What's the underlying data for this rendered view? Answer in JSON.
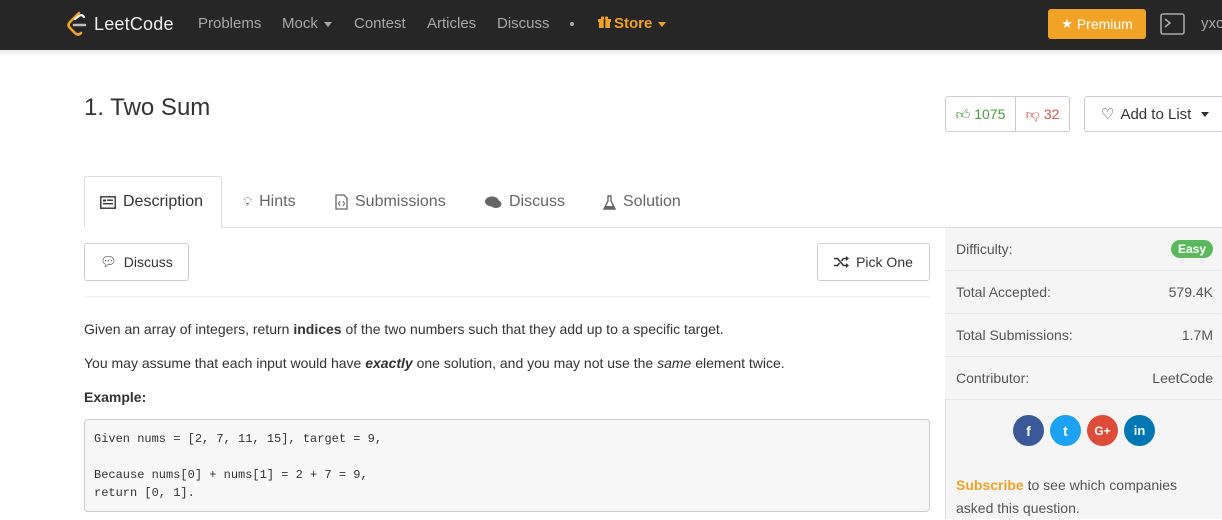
{
  "navbar": {
    "logo_text": "LeetCode",
    "items": [
      "Problems",
      "Mock",
      "Contest",
      "Articles",
      "Discuss"
    ],
    "store_label": "Store",
    "premium_label": "Premium",
    "user_partial": "yxc"
  },
  "problem": {
    "title": "1. Two Sum",
    "likes": "1075",
    "dislikes": "32",
    "add_to_list": "Add to List"
  },
  "tabs": [
    {
      "label": "Description",
      "icon": "description-icon"
    },
    {
      "label": "Hints",
      "icon": "lightbulb-icon"
    },
    {
      "label": "Submissions",
      "icon": "code-file-icon"
    },
    {
      "label": "Discuss",
      "icon": "comments-icon"
    },
    {
      "label": "Solution",
      "icon": "flask-icon"
    }
  ],
  "actions": {
    "discuss": "Discuss",
    "pick_one": "Pick One"
  },
  "description": {
    "p1_a": "Given an array of integers, return ",
    "p1_b": "indices",
    "p1_c": " of the two numbers such that they add up to a specific target.",
    "p2_a": "You may assume that each input would have ",
    "p2_b": "exactly",
    "p2_c": " one solution, and you may not use the ",
    "p2_d": "same",
    "p2_e": " element twice.",
    "example_label": "Example:",
    "example_code": "Given nums = [2, 7, 11, 15], target = 9,\n\nBecause nums[0] + nums[1] = 2 + 7 = 9,\nreturn [0, 1]."
  },
  "sidebar": {
    "difficulty_label": "Difficulty:",
    "difficulty_value": "Easy",
    "accepted_label": "Total Accepted:",
    "accepted_value": "579.4K",
    "submissions_label": "Total Submissions:",
    "submissions_value": "1.7M",
    "contributor_label": "Contributor:",
    "contributor_value": "LeetCode",
    "social": [
      {
        "icon": "facebook-icon",
        "glyph": "f",
        "color": "#3b5998"
      },
      {
        "icon": "twitter-icon",
        "glyph": "t",
        "color": "#1da1f2"
      },
      {
        "icon": "google-plus-icon",
        "glyph": "G+",
        "color": "#dd4b39"
      },
      {
        "icon": "linkedin-icon",
        "glyph": "in",
        "color": "#0077b5"
      }
    ],
    "subscribe_link": "Subscribe",
    "subscribe_text": " to see which companies asked this question."
  },
  "colors": {
    "accent": "#f0a326",
    "easy": "#5cb85c",
    "navbar": "#262626"
  }
}
